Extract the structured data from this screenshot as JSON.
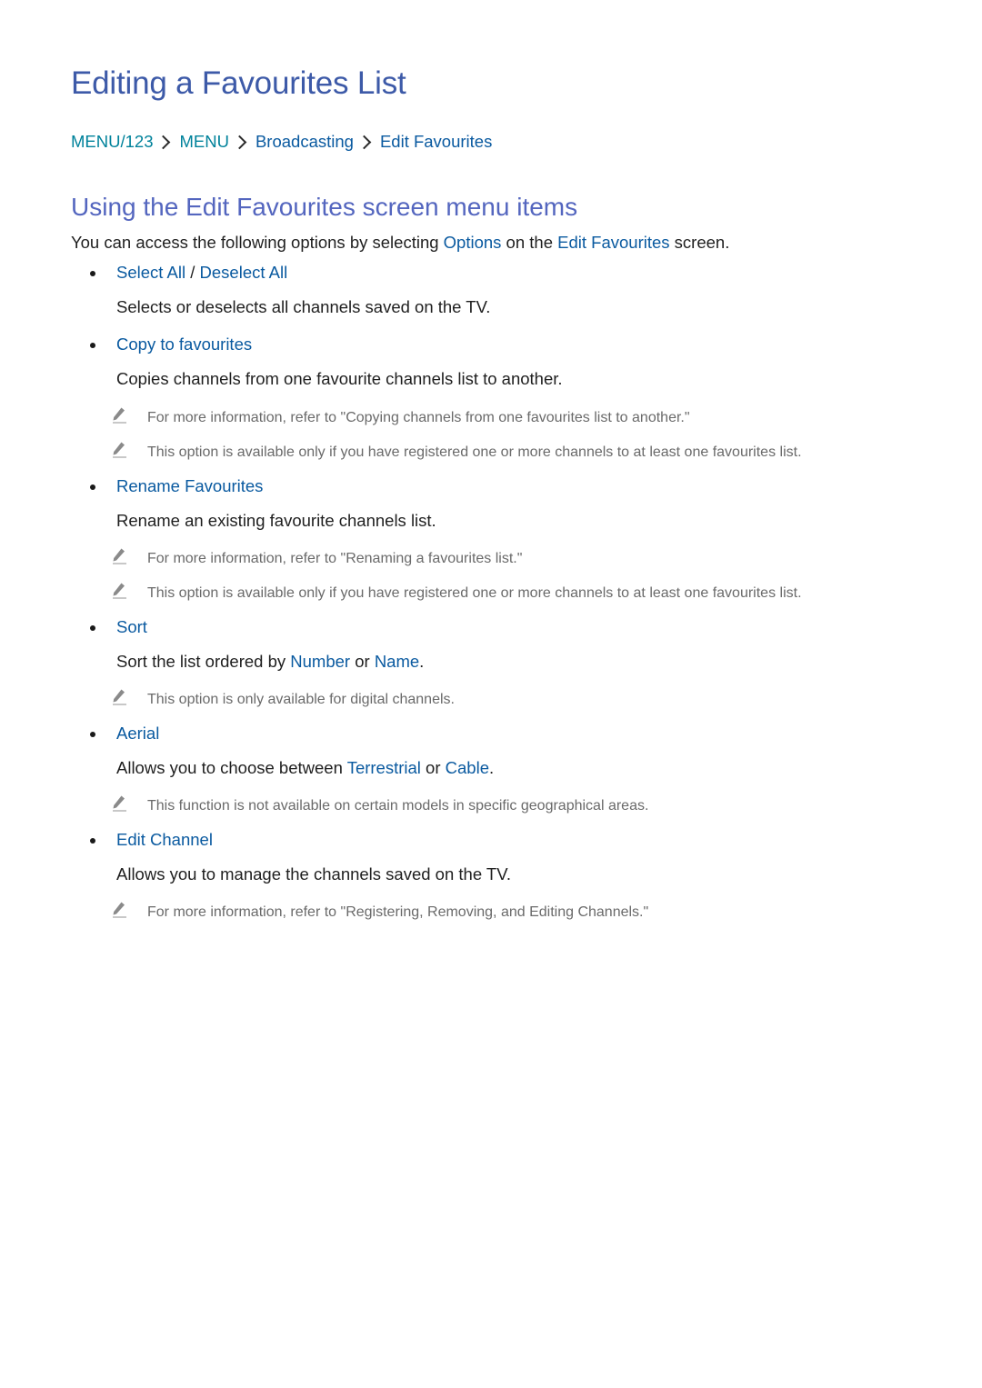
{
  "title": "Editing a Favourites List",
  "breadcrumb": [
    {
      "label": "MENU/123",
      "color": "#00829b"
    },
    {
      "label": "MENU",
      "color": "#00829b"
    },
    {
      "label": "Broadcasting",
      "color": "#0a5aa0"
    },
    {
      "label": "Edit Favourites",
      "color": "#0a5aa0"
    }
  ],
  "subtitle": "Using the Edit Favourites screen menu items",
  "intro": {
    "before": "You can access the following options by selecting ",
    "link1": "Options",
    "middle": " on the ",
    "link2": "Edit Favourites",
    "after": " screen."
  },
  "items": [
    {
      "label": "Select All",
      "separator": " / ",
      "label2": "Deselect All",
      "description": "Selects or deselects all channels saved on the TV.",
      "notes": []
    },
    {
      "label": "Copy to favourites",
      "description": "Copies channels from one favourite channels list to another.",
      "notes": [
        "For more information, refer to \"Copying channels from one favourites list to another.\"",
        "This option is available only if you have registered one or more channels to at least one favourites list."
      ]
    },
    {
      "label": "Rename Favourites",
      "description": "Rename an existing favourite channels list.",
      "notes": [
        "For more information, refer to \"Renaming a favourites list.\"",
        "This option is available only if you have registered one or more channels to at least one favourites list."
      ]
    },
    {
      "label": "Sort",
      "description_parts": {
        "before": "Sort the list ordered by ",
        "link1": "Number",
        "middle": " or ",
        "link2": "Name",
        "after": "."
      },
      "notes": [
        "This option is only available for digital channels."
      ]
    },
    {
      "label": "Aerial",
      "description_parts": {
        "before": "Allows you to choose between ",
        "link1": "Terrestrial",
        "middle": " or ",
        "link2": "Cable",
        "after": "."
      },
      "notes": [
        "This function is not available on certain models in specific geographical areas."
      ]
    },
    {
      "label": "Edit Channel",
      "description": "Allows you to manage the channels saved on the TV.",
      "notes": [
        "For more information, refer to \"Registering, Removing, and Editing Channels.\""
      ]
    }
  ],
  "icons": {
    "note": "pencil-icon",
    "breadcrumb_separator": "chevron-right-icon",
    "bullet": "bullet-icon"
  },
  "colors": {
    "title": "#3d5aa8",
    "subtitle": "#5466bf",
    "link": "#0a5aa0",
    "breadcrumb_menu": "#00829b",
    "body_text": "#1f1f1f",
    "note_text": "#6a6a6a"
  }
}
